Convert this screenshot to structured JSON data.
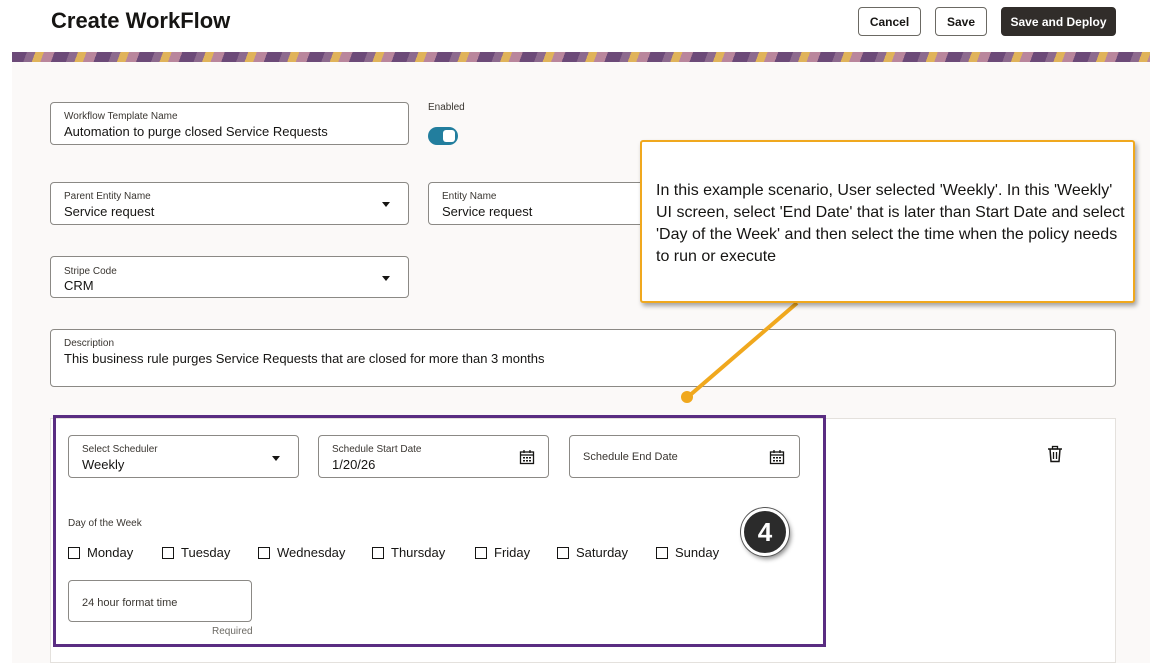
{
  "header": {
    "title": "Create WorkFlow",
    "cancel_label": "Cancel",
    "save_label": "Save",
    "save_deploy_label": "Save and Deploy"
  },
  "form": {
    "template_name": {
      "label": "Workflow Template Name",
      "value": "Automation to purge closed Service Requests"
    },
    "enabled": {
      "label": "Enabled",
      "checked": true
    },
    "parent_entity": {
      "label": "Parent Entity Name",
      "value": "Service request"
    },
    "entity": {
      "label": "Entity Name",
      "value": "Service request"
    },
    "stripe_code": {
      "label": "Stripe Code",
      "value": "CRM"
    },
    "description": {
      "label": "Description",
      "value": "This business rule purges Service Requests that are closed for more than 3 months"
    }
  },
  "scheduler": {
    "select_scheduler": {
      "label": "Select Scheduler",
      "value": "Weekly"
    },
    "start_date": {
      "label": "Schedule Start Date",
      "value": "1/20/26"
    },
    "end_date": {
      "placeholder": "Schedule End Date"
    },
    "day_of_week_label": "Day of the Week",
    "days": [
      "Monday",
      "Tuesday",
      "Wednesday",
      "Thursday",
      "Friday",
      "Saturday",
      "Sunday"
    ],
    "time": {
      "placeholder": "24 hour format time",
      "required_text": "Required"
    }
  },
  "annotation": {
    "callout_text": "In this example scenario, User selected 'Weekly'. In this 'Weekly' UI screen, select 'End Date' that is later than Start Date and select 'Day of the Week' and then select the time when the policy needs to run or execute",
    "step_number": "4"
  },
  "colors": {
    "accent": "#227e9e",
    "highlight_border": "#5a2d82",
    "callout_border": "#f0a81e",
    "primary_button": "#312d2a"
  }
}
